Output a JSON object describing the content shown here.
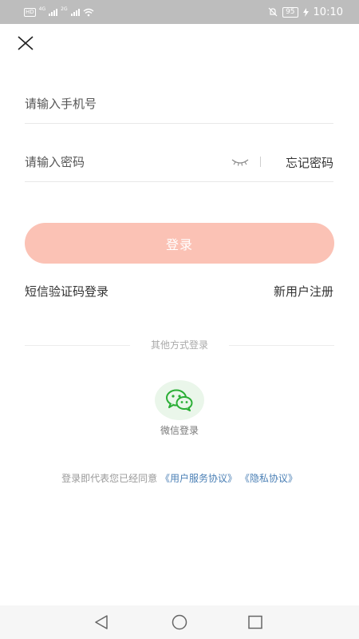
{
  "status_bar": {
    "hd_badge": "HD",
    "net1": "4G",
    "net2": "2G",
    "battery": "95",
    "time": "10:10"
  },
  "login_form": {
    "phone_placeholder": "请输入手机号",
    "phone_value": "",
    "password_placeholder": "请输入密码",
    "password_value": "",
    "forgot_label": "忘记密码",
    "submit_label": "登录",
    "sms_login_label": "短信验证码登录",
    "register_label": "新用户注册"
  },
  "other_methods": {
    "divider_label": "其他方式登录",
    "wechat_label": "微信登录"
  },
  "agreement": {
    "prefix": "登录即代表您已经同意",
    "terms_link": "《用户服务协议》",
    "privacy_link": "《隐私协议》"
  },
  "colors": {
    "button_bg": "#fbc2b5",
    "wechat_green": "#2aae35",
    "link_blue": "#4a7fb5"
  }
}
